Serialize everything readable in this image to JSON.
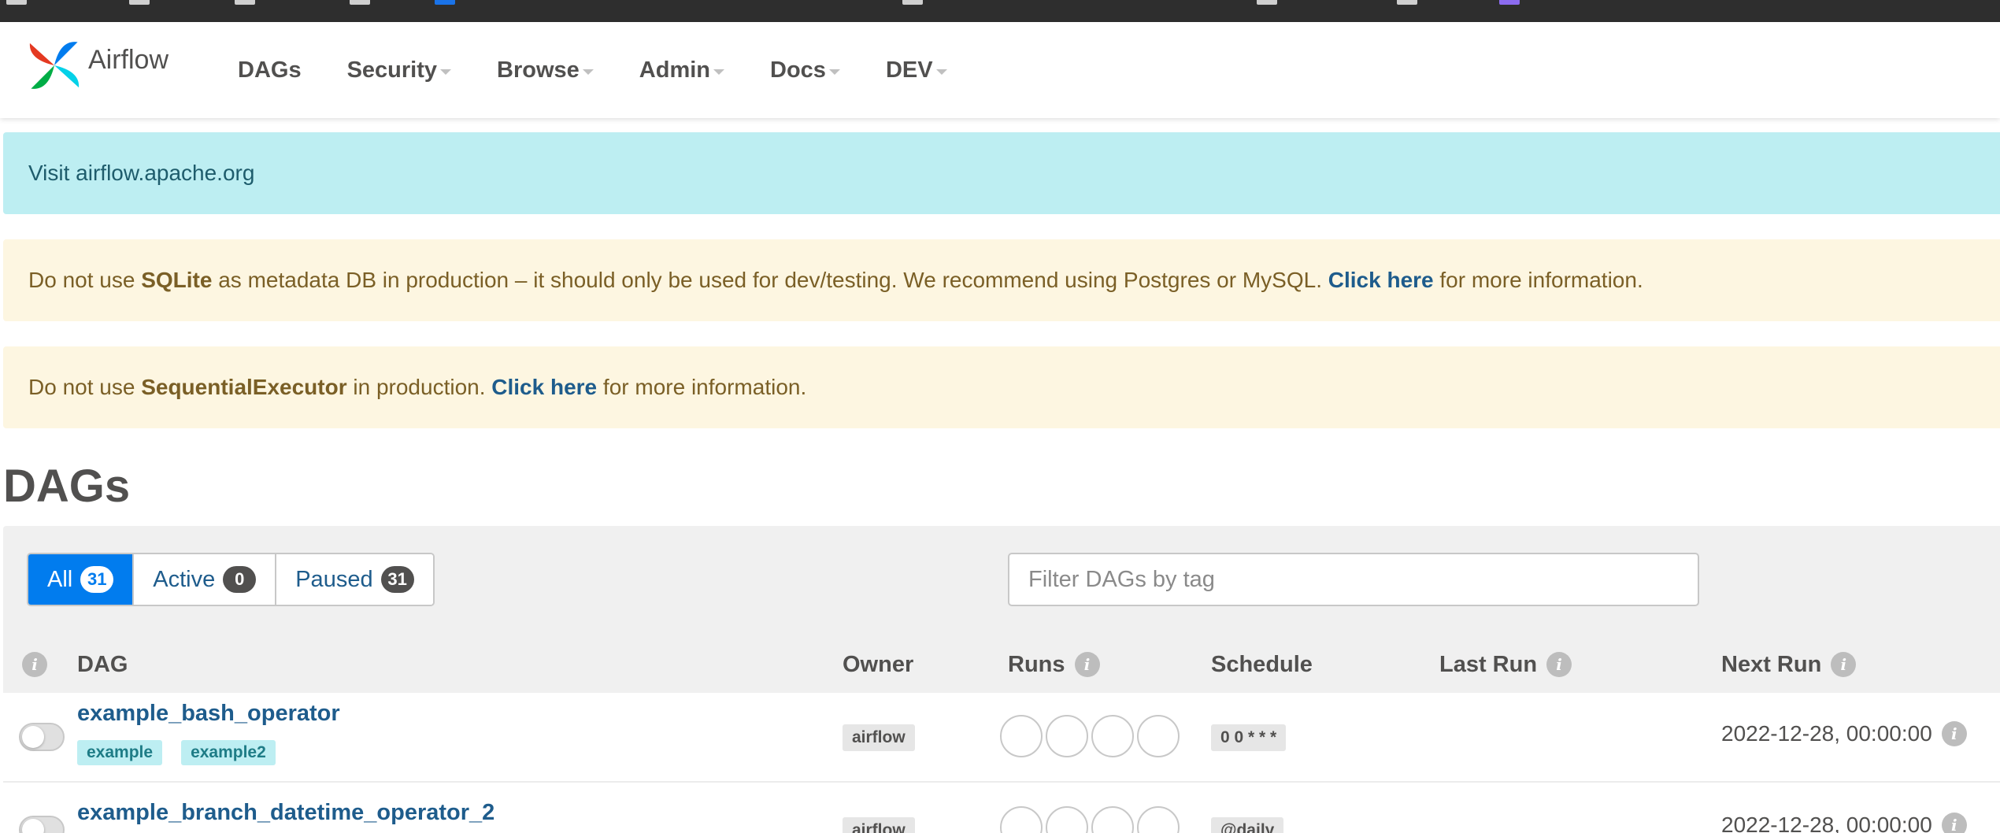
{
  "brand": {
    "name": "Airflow"
  },
  "nav": {
    "items": [
      {
        "label": "DAGs",
        "dropdown": false
      },
      {
        "label": "Security",
        "dropdown": true
      },
      {
        "label": "Browse",
        "dropdown": true
      },
      {
        "label": "Admin",
        "dropdown": true
      },
      {
        "label": "Docs",
        "dropdown": true
      },
      {
        "label": "DEV",
        "dropdown": true
      }
    ]
  },
  "alerts": {
    "info": {
      "text": "Visit airflow.apache.org"
    },
    "sqlite": {
      "prefix": "Do not use ",
      "bold": "SQLite",
      "middle": " as metadata DB in production – it should only be used for dev/testing. We recommend using Postgres or MySQL. ",
      "link": "Click here",
      "suffix": " for more information."
    },
    "executor": {
      "prefix": "Do not use ",
      "bold": "SequentialExecutor",
      "middle": " in production. ",
      "link": "Click here",
      "suffix": " for more information."
    }
  },
  "page": {
    "title": "DAGs"
  },
  "filters": {
    "all": {
      "label": "All",
      "count": "31"
    },
    "active": {
      "label": "Active",
      "count": "0"
    },
    "paused": {
      "label": "Paused",
      "count": "31"
    },
    "tag_placeholder": "Filter DAGs by tag"
  },
  "table": {
    "columns": {
      "dag": "DAG",
      "owner": "Owner",
      "runs": "Runs",
      "schedule": "Schedule",
      "last_run": "Last Run",
      "next_run": "Next Run"
    },
    "rows": [
      {
        "name": "example_bash_operator",
        "tags": [
          "example",
          "example2"
        ],
        "owner": "airflow",
        "schedule": "0 0 * * *",
        "next_run": "2022-12-28, 00:00:00",
        "paused": true
      },
      {
        "name": "example_branch_datetime_operator_2",
        "tags": [],
        "owner": "airflow",
        "schedule": "@daily",
        "next_run": "2022-12-28, 00:00:00",
        "paused": true
      }
    ]
  },
  "colors": {
    "primary": "#017cee",
    "link": "#1e5c8c",
    "info_bg": "#bdeef2",
    "warn_bg": "#fdf6e1",
    "logo_red": "#e43921",
    "logo_blue": "#017cee",
    "logo_teal": "#00ad46",
    "logo_cyan": "#04d1e8"
  }
}
